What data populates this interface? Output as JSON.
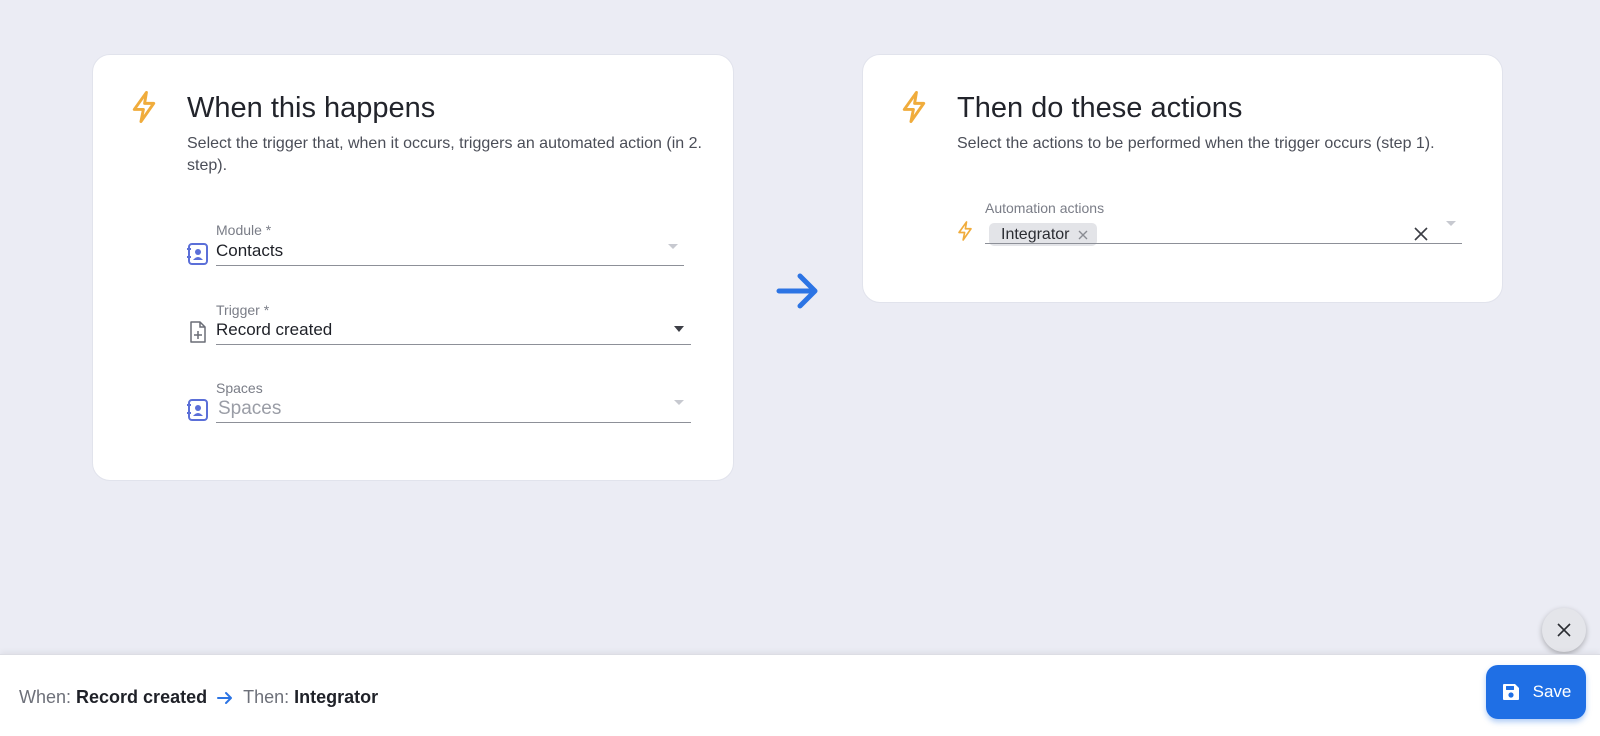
{
  "trigger_card": {
    "icon": "lightning-bolt-icon",
    "title": "When this happens",
    "description": "Select the trigger that, when it occurs, triggers an automated action (in 2. step).",
    "fields": {
      "module": {
        "label": "Module *",
        "value": "Contacts",
        "icon": "contact-book-icon"
      },
      "trigger": {
        "label": "Trigger *",
        "value": "Record created",
        "icon": "file-plus-icon"
      },
      "spaces": {
        "label": "Spaces",
        "placeholder": "Spaces",
        "icon": "contact-book-icon"
      }
    }
  },
  "action_card": {
    "icon": "lightning-bolt-icon",
    "title": "Then do these actions",
    "description": "Select the actions to be performed when the trigger occurs (step 1).",
    "fields": {
      "automation_actions": {
        "label": "Automation actions",
        "chips": [
          "Integrator"
        ],
        "icon": "lightning-bolt-icon"
      }
    }
  },
  "footer": {
    "when_label": "When:",
    "when_value": "Record created",
    "then_label": "Then:",
    "then_value": "Integrator",
    "save_label": "Save"
  },
  "colors": {
    "accent": "#1f6fe5",
    "bolt": "#f0ac3c",
    "field_icon": "#5b6fd8",
    "background": "#ebecf4"
  }
}
